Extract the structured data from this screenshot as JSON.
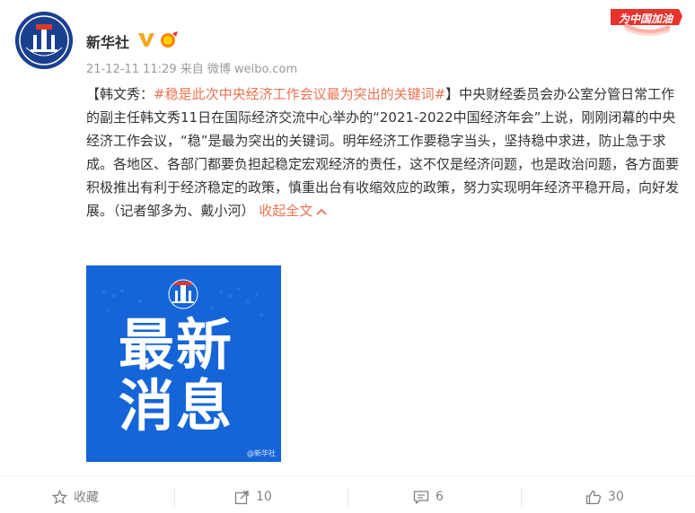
{
  "user": {
    "name": "新华社",
    "avatar_text": "XINHUA",
    "verified_icon": "verified-v-icon",
    "medal_icon": "medal-icon"
  },
  "meta": {
    "time_source": "21-12-11 11:29 来自 微博 weibo.com"
  },
  "badge": {
    "text": "为中国加油"
  },
  "post": {
    "bracket_open": "【韩文秀：",
    "hashtag": "#稳是此次中央经济工作会议最为突出的关键词#",
    "body": "】中央财经委员会办公室分管日常工作的副主任韩文秀11日在国际经济交流中心举办的“2021-2022中国经济年会”上说，刚刚闭幕的中央经济工作会议，“稳”是最为突出的关键词。明年经济工作要稳字当头，坚持稳中求进，防止急于求成。各地区、各部门都要负担起稳定宏观经济的责任，这不仅是经济问题，也是政治问题，各方面要积极推出有利于经济稳定的政策，慎重出台有收缩效应的政策，努力实现明年经济平稳开局，向好发展。（记者邹多为、戴小河）",
    "collapse_label": "收起全文",
    "collapse_icon": "chevron-up-icon"
  },
  "image": {
    "line1": "最新",
    "line2": "消息",
    "watermark": "@新华社"
  },
  "actions": {
    "favorite_label": "收藏",
    "repost_count": "10",
    "comment_count": "6",
    "like_count": "30"
  },
  "colors": {
    "accent": "#eb7350",
    "image_bg": "#1565d8",
    "avatar_bg": "#1b3f8f",
    "verified": "#f5a623",
    "badge_red": "#e8332c"
  }
}
